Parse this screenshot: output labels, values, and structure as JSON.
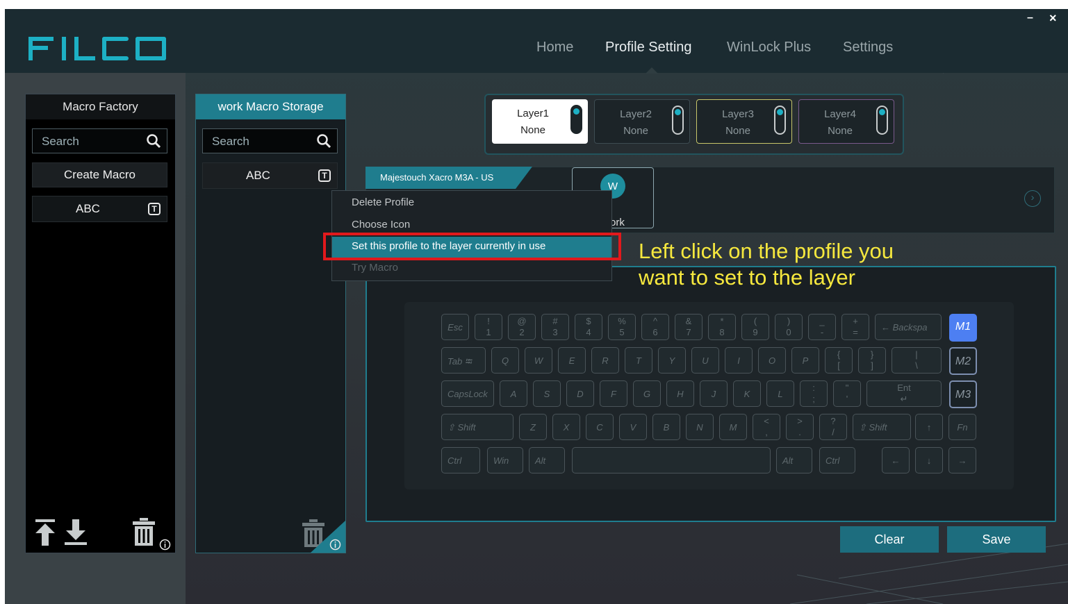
{
  "header": {
    "logo_text": "FILCO",
    "nav": [
      "Home",
      "Profile Setting",
      "WinLock Plus",
      "Settings"
    ],
    "active_nav": "Profile Setting",
    "minimize": "–",
    "close": "×"
  },
  "macro_factory": {
    "title": "Macro Factory",
    "search_placeholder": "Search",
    "create_label": "Create Macro",
    "items": [
      {
        "label": "ABC",
        "badge": "T"
      }
    ]
  },
  "macro_storage": {
    "title": "work Macro Storage",
    "search_placeholder": "Search",
    "items": [
      {
        "label": "ABC",
        "badge": "T"
      }
    ]
  },
  "layers": [
    {
      "name": "Layer1",
      "value": "None",
      "active": true
    },
    {
      "name": "Layer2",
      "value": "None",
      "active": false
    },
    {
      "name": "Layer3",
      "value": "None",
      "active": false
    },
    {
      "name": "Layer4",
      "value": "None",
      "active": false
    }
  ],
  "profile": {
    "tab_label": "Majestouch Xacro M3A - US",
    "avatar_letter": "W",
    "name_visible": "ork"
  },
  "context_menu": {
    "items": [
      {
        "label": "Delete Profile"
      },
      {
        "label": "Choose Icon"
      },
      {
        "label": "Set this profile to the layer currently in use"
      },
      {
        "label": "Try Macro"
      }
    ]
  },
  "callout": {
    "line1": "Left click on the profile you",
    "line2": "want to set to the layer"
  },
  "keyboard": {
    "row1": [
      {
        "c": "Esc"
      },
      {
        "t": "!",
        "b": "1"
      },
      {
        "t": "@",
        "b": "2"
      },
      {
        "t": "#",
        "b": "3"
      },
      {
        "t": "$",
        "b": "4"
      },
      {
        "t": "%",
        "b": "5"
      },
      {
        "t": "^",
        "b": "6"
      },
      {
        "t": "&",
        "b": "7"
      },
      {
        "t": "*",
        "b": "8"
      },
      {
        "t": "(",
        "b": "9"
      },
      {
        "t": ")",
        "b": "0"
      },
      {
        "t": "_",
        "b": "-"
      },
      {
        "t": "+",
        "b": "="
      },
      {
        "c": "← Backspa"
      }
    ],
    "row2": [
      {
        "c": "Tab ⭾"
      },
      {
        "c": "Q"
      },
      {
        "c": "W"
      },
      {
        "c": "E"
      },
      {
        "c": "R"
      },
      {
        "c": "T"
      },
      {
        "c": "Y"
      },
      {
        "c": "U"
      },
      {
        "c": "I"
      },
      {
        "c": "O"
      },
      {
        "c": "P"
      },
      {
        "t": "{",
        "b": "["
      },
      {
        "t": "}",
        "b": "]"
      },
      {
        "t": "|",
        "b": "\\"
      }
    ],
    "row3": [
      {
        "c": "CapsLock"
      },
      {
        "c": "A"
      },
      {
        "c": "S"
      },
      {
        "c": "D"
      },
      {
        "c": "F"
      },
      {
        "c": "G"
      },
      {
        "c": "H"
      },
      {
        "c": "J"
      },
      {
        "c": "K"
      },
      {
        "c": "L"
      },
      {
        "t": ":",
        "b": ";"
      },
      {
        "t": "\"",
        "b": "'"
      },
      {
        "t": "Ent",
        "b": "↵"
      }
    ],
    "row4": [
      {
        "c": "⇧ Shift"
      },
      {
        "c": "Z"
      },
      {
        "c": "X"
      },
      {
        "c": "C"
      },
      {
        "c": "V"
      },
      {
        "c": "B"
      },
      {
        "c": "N"
      },
      {
        "c": "M"
      },
      {
        "t": "<",
        "b": ","
      },
      {
        "t": ">",
        "b": "."
      },
      {
        "t": "?",
        "b": "/"
      },
      {
        "c": "⇧ Shift"
      },
      {
        "c": "↑"
      },
      {
        "c": "Fn"
      }
    ],
    "row5": [
      {
        "c": "Ctrl"
      },
      {
        "c": "Win"
      },
      {
        "c": "Alt"
      },
      {
        "c": ""
      },
      {
        "c": "Alt"
      },
      {
        "c": "Ctrl"
      },
      {
        "c": "←"
      },
      {
        "c": "↓"
      },
      {
        "c": "→"
      }
    ],
    "macro_keys": [
      "M1",
      "M2",
      "M3"
    ]
  },
  "actions": {
    "clear": "Clear",
    "save": "Save"
  },
  "colors": {
    "accent": "#1f7d8e",
    "highlight_box": "#e1191c",
    "callout_text": "#f6e83e",
    "m1_active": "#4d7ff2"
  }
}
